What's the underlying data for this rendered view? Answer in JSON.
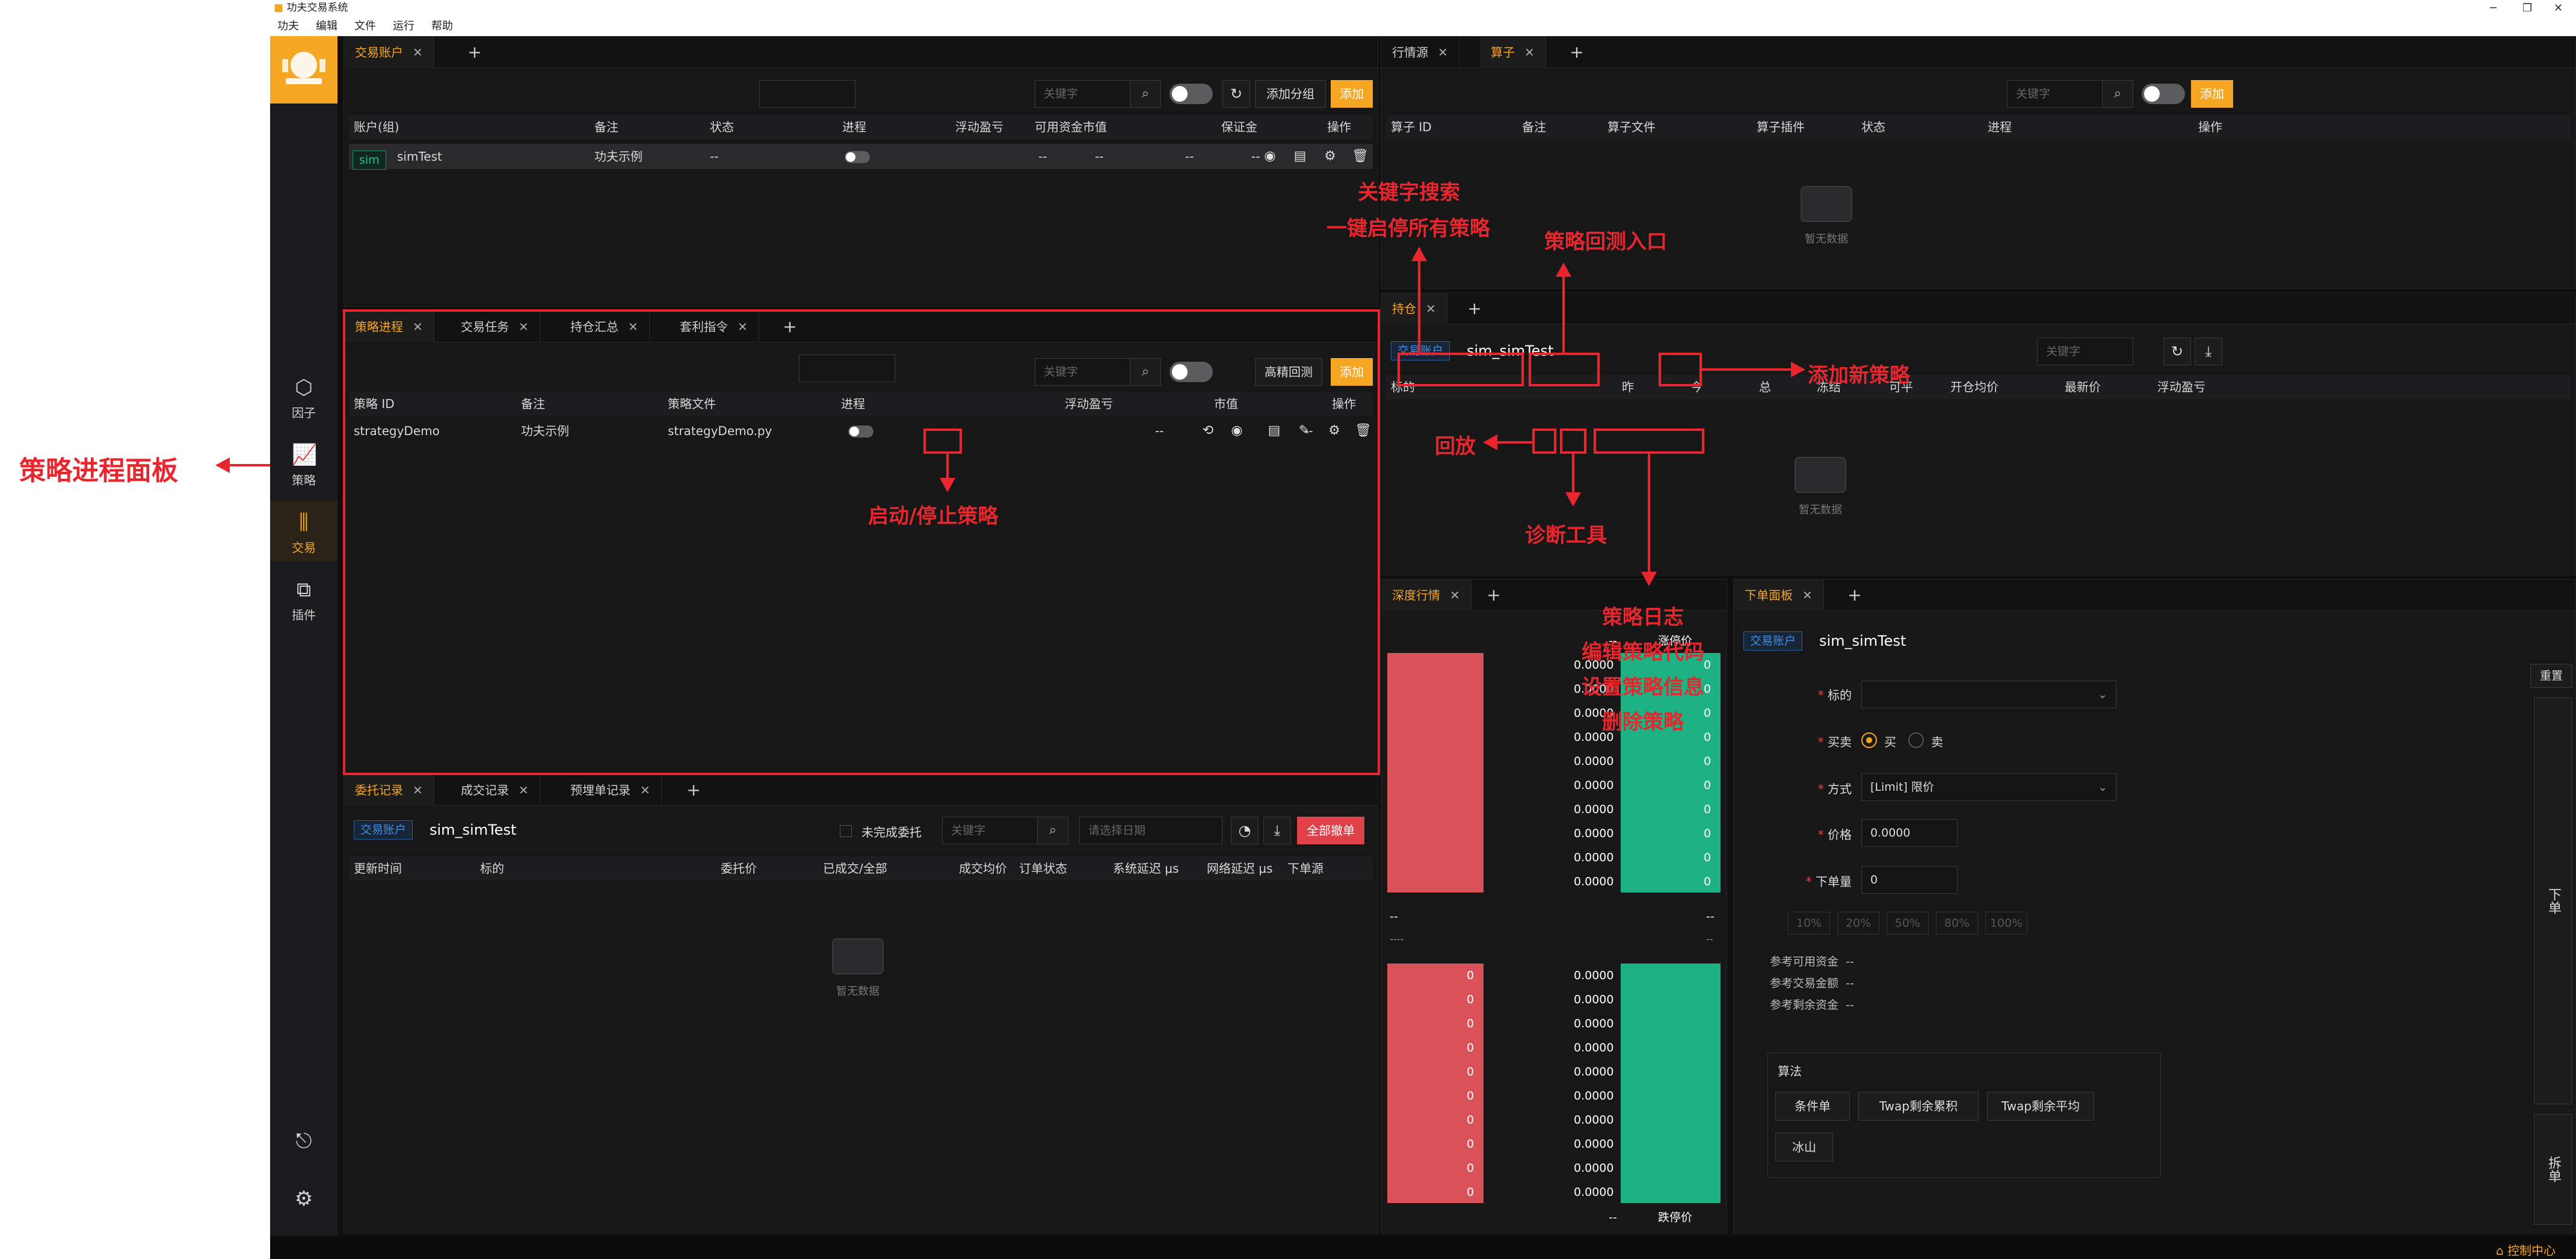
{
  "window": {
    "title": "功夫交易系统",
    "menu": [
      "功夫",
      "编辑",
      "文件",
      "运行",
      "帮助"
    ]
  },
  "nav": [
    {
      "label": "因子",
      "icon": "cube-icon"
    },
    {
      "label": "策略",
      "icon": "chart-icon"
    },
    {
      "label": "交易",
      "icon": "trade-icon"
    },
    {
      "label": "插件",
      "icon": "plugin-icon"
    }
  ],
  "accounts": {
    "tab": "交易账户",
    "search_placeholder": "关键字",
    "add_group": "添加分组",
    "add": "添加",
    "cols": [
      "账户(组)",
      "备注",
      "状态",
      "进程",
      "浮动盈亏",
      "市值",
      "保证金",
      "可用资金",
      "操作"
    ],
    "row": {
      "tag": "sim",
      "name": "simTest",
      "note": "功夫示例",
      "status": "--",
      "pnl": "--",
      "mv": "--",
      "margin": "--",
      "avail": "--"
    }
  },
  "market": {
    "tabs": [
      "行情源",
      "算子"
    ],
    "search_placeholder": "关键字",
    "add": "添加",
    "cols": [
      "算子 ID",
      "备注",
      "算子文件",
      "算子插件",
      "状态",
      "进程",
      "操作"
    ],
    "empty": "暂无数据"
  },
  "strategy": {
    "tabs": [
      "策略进程",
      "交易任务",
      "持仓汇总",
      "套利指令"
    ],
    "search_placeholder": "关键字",
    "backtest": "高精回测",
    "add": "添加",
    "cols": [
      "策略 ID",
      "备注",
      "策略文件",
      "进程",
      "浮动盈亏",
      "市值",
      "操作"
    ],
    "row": {
      "id": "strategyDemo",
      "note": "功夫示例",
      "file": "strategyDemo.py",
      "pnl": "--",
      "mv": "--"
    }
  },
  "position": {
    "tab": "持仓",
    "tag": "交易账户",
    "account": "sim_simTest",
    "search_placeholder": "关键字",
    "cols": [
      "标的",
      "",
      "昨",
      "今",
      "总",
      "冻结",
      "可平",
      "开仓均价",
      "最新价",
      "浮动盈亏"
    ],
    "empty": "暂无数据"
  },
  "orders": {
    "tabs": [
      "委托记录",
      "成交记录",
      "预埋单记录"
    ],
    "tag": "交易账户",
    "account": "sim_simTest",
    "unfinished": "未完成委托",
    "search_placeholder": "关键字",
    "date_placeholder": "请选择日期",
    "cancel_all": "全部撤单",
    "cols": [
      "更新时间",
      "标的",
      "委托价",
      "已成交/全部",
      "成交均价",
      "订单状态",
      "系统延迟 μs",
      "网络延迟 μs",
      "下单源"
    ],
    "empty": "暂无数据"
  },
  "depth": {
    "tab": "深度行情",
    "top_left": "--",
    "upper": "涨停价",
    "lower": "跌停价",
    "mid_left": "--",
    "mid_right": "--",
    "mid_sub": "----",
    "mid_sub_right": "--",
    "asks": [
      "0.0000",
      "0.0000",
      "0.0000",
      "0.0000",
      "0.0000",
      "0.0000",
      "0.0000",
      "0.0000",
      "0.0000",
      "0.0000"
    ],
    "ask_vol": [
      "0",
      "0",
      "0",
      "0",
      "0",
      "0",
      "0",
      "0",
      "0",
      "0"
    ],
    "bids": [
      "0.0000",
      "0.0000",
      "0.0000",
      "0.0000",
      "0.0000",
      "0.0000",
      "0.0000",
      "0.0000",
      "0.0000",
      "0.0000"
    ],
    "bid_vol": [
      "0",
      "0",
      "0",
      "0",
      "0",
      "0",
      "0",
      "0",
      "0",
      "0"
    ]
  },
  "orderpanel": {
    "tab": "下单面板",
    "tag": "交易账户",
    "account": "sim_simTest",
    "reset": "重置",
    "symbol_label": "标的",
    "side_label": "买卖",
    "buy": "买",
    "sell": "卖",
    "method_label": "方式",
    "method_value": "[Limit] 限价",
    "price_label": "价格",
    "price_value": "0.0000",
    "qty_label": "下单量",
    "qty_value": "0",
    "pcts": [
      "10%",
      "20%",
      "50%",
      "80%",
      "100%"
    ],
    "ref_avail": "参考可用资金",
    "ref_amount": "参考交易金额",
    "ref_remain": "参考剩余资金",
    "ref_value": "--",
    "algo": "算法",
    "algo_btns": [
      "条件单",
      "Twap剩余累积",
      "Twap剩余平均",
      "冰山"
    ],
    "place": "下单",
    "split": "拆单"
  },
  "status": {
    "control": "控制中心"
  },
  "annotations": {
    "panel": "策略进程面板",
    "search": "关键字搜索",
    "toggle_all": "一键启停所有策略",
    "backtest": "策略回测入口",
    "add": "添加新策略",
    "replay": "回放",
    "startstop": "启动/停止策略",
    "diag": "诊断工具",
    "log": "策略日志",
    "edit": "编辑策略代码",
    "settings": "设置策略信息",
    "delete": "删除策略"
  },
  "colors": {
    "accent": "#f5a623",
    "annotation": "#e8262e",
    "ask": "#d9525a",
    "bid": "#1db184"
  }
}
